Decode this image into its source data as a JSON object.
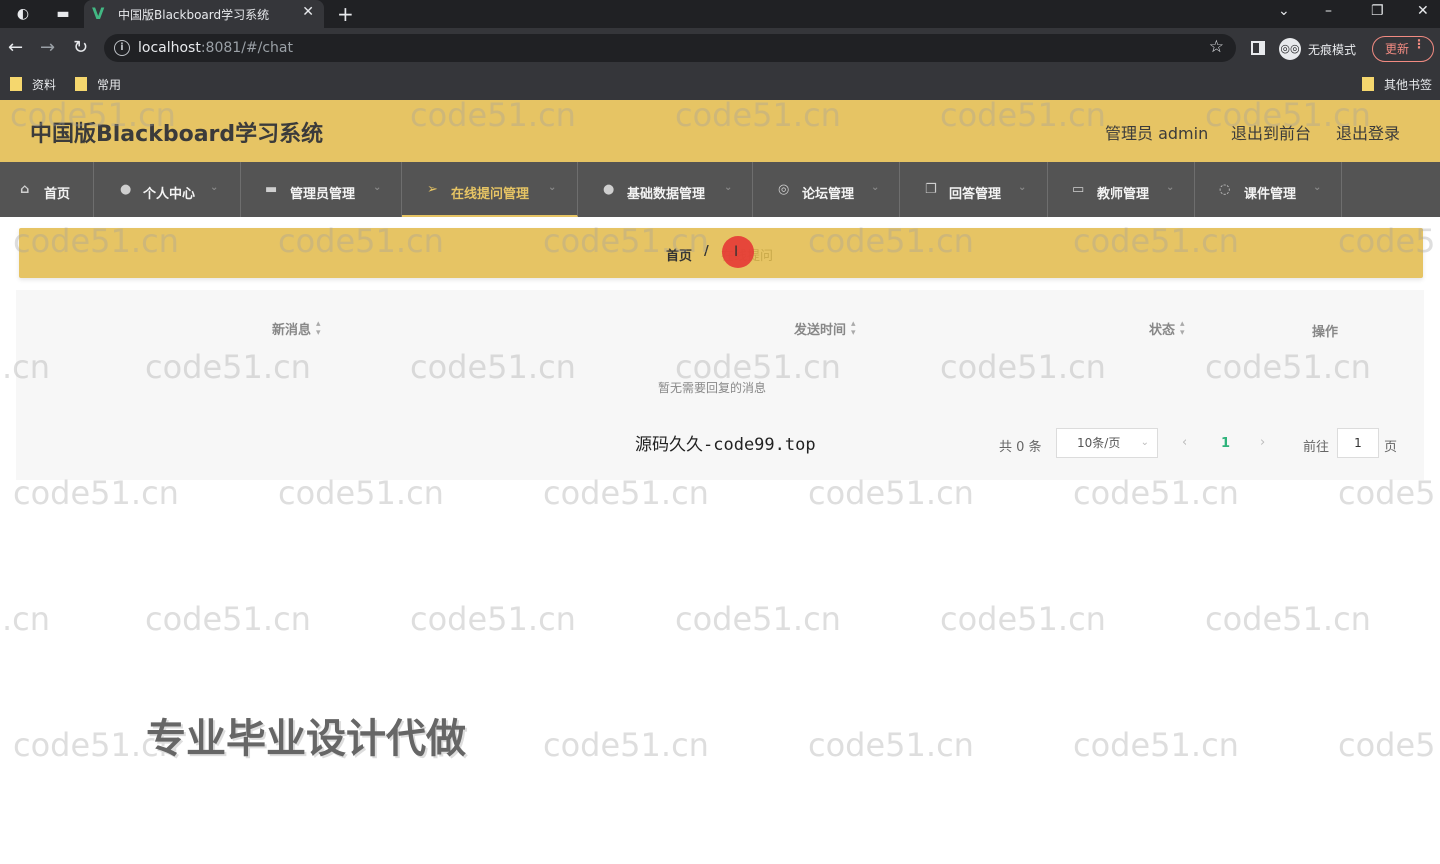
{
  "browser": {
    "tab_title": "中国版Blackboard学习系统",
    "url_host": "localhost",
    "url_path": ":8081/#/chat",
    "incognito_label": "无痕模式",
    "update_label": "更新",
    "bookmarks": [
      "资料",
      "常用"
    ],
    "other_bookmarks": "其他书签",
    "icons": [
      "globe-icon",
      "window-icon",
      "vue-icon",
      "close-icon",
      "plus-icon",
      "back-icon",
      "forward-icon",
      "reload-icon",
      "info-icon",
      "star-icon",
      "incognito-icon",
      "folder-icon"
    ]
  },
  "header": {
    "title": "中国版Blackboard学习系统",
    "user": "管理员 admin",
    "front_link": "退出到前台",
    "logout_link": "退出登录"
  },
  "menu": {
    "items": [
      {
        "label": "首页",
        "icon": "home-icon"
      },
      {
        "label": "个人中心",
        "icon": "user-icon"
      },
      {
        "label": "管理员管理",
        "icon": "folder-icon"
      },
      {
        "label": "在线提问管理",
        "icon": "send-icon"
      },
      {
        "label": "基础数据管理",
        "icon": "lightbulb-icon"
      },
      {
        "label": "论坛管理",
        "icon": "compass-icon"
      },
      {
        "label": "回答管理",
        "icon": "copy-icon"
      },
      {
        "label": "教师管理",
        "icon": "card-icon"
      },
      {
        "label": "课件管理",
        "icon": "clock-icon"
      }
    ],
    "active_color": "#e6c464"
  },
  "breadcrumb": {
    "home": "首页",
    "separator": "/",
    "current": "在线提问"
  },
  "table": {
    "columns": [
      "新消息",
      "发送时间",
      "状态",
      "操作"
    ],
    "empty_text": "暂无需要回复的消息"
  },
  "pagination": {
    "total": "共 0 条",
    "page_size": "10条/页",
    "current_page": "1",
    "goto_label": "前往",
    "goto_value": "1",
    "page_unit": "页"
  },
  "watermarks": {
    "site": "code51.cn",
    "partial_left": ".cn",
    "partial_right": "code5",
    "source": "源码久久-code99.top",
    "ad": "专业毕业设计代做"
  },
  "colors": {
    "header_bg": "#e6c464",
    "menu_bg": "#545454",
    "page_number": "#2fb37b"
  }
}
